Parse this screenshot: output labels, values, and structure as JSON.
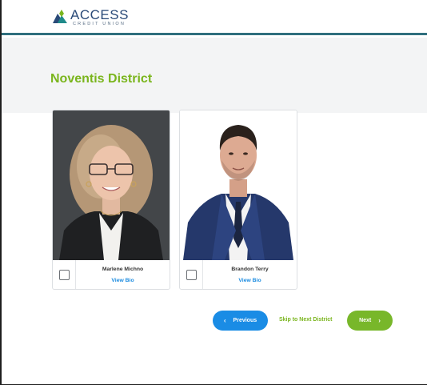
{
  "header": {
    "logo_word": "ACCESS",
    "logo_sub": "CREDIT UNION"
  },
  "district": {
    "title": "Noventis District"
  },
  "candidates": [
    {
      "name": "Marlene Michno",
      "bio_label": "View Bio",
      "checked": false
    },
    {
      "name": "Brandon Terry",
      "bio_label": "View Bio",
      "checked": false
    }
  ],
  "navigation": {
    "previous_label": "Previous",
    "skip_label": "Skip to Next District",
    "next_label": "Next"
  },
  "colors": {
    "brand_green": "#7ab51d",
    "primary_blue": "#1a8ce5",
    "header_rule": "#2f6f7e",
    "logo_blue": "#2a4a78"
  }
}
